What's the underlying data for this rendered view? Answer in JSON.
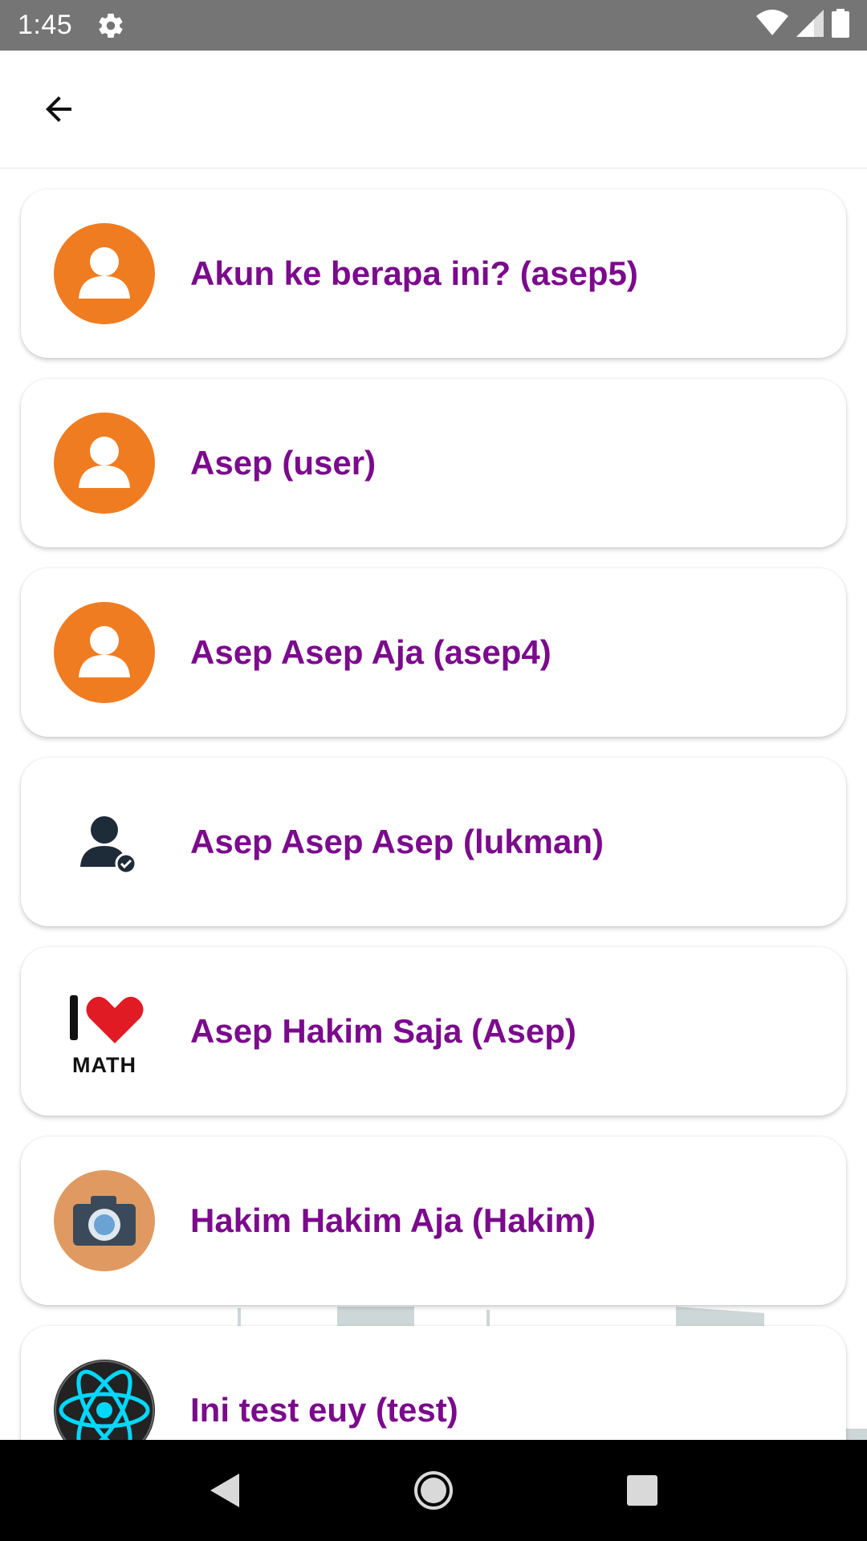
{
  "status_bar": {
    "time": "1:45",
    "icons": [
      "gear-icon",
      "wifi-icon",
      "signal-icon",
      "battery-icon"
    ]
  },
  "app_bar": {
    "back_icon": "arrow-back-icon"
  },
  "accounts": [
    {
      "label": "Akun ke berapa ini? (asep5)",
      "avatar": "default-user-avatar"
    },
    {
      "label": "Asep (user)",
      "avatar": "default-user-avatar"
    },
    {
      "label": "Asep Asep Aja (asep4)",
      "avatar": "default-user-avatar"
    },
    {
      "label": "Asep Asep Asep (lukman)",
      "avatar": "verified-user-avatar"
    },
    {
      "label": "Asep Hakim Saja (Asep)",
      "avatar": "i-love-math-avatar",
      "avatar_text": "MATH"
    },
    {
      "label": "Hakim Hakim Aja (Hakim)",
      "avatar": "camera-avatar"
    },
    {
      "label": "Ini test euy (test)",
      "avatar": "react-logo-avatar"
    }
  ],
  "colors": {
    "status_bar": "#757575",
    "label_text": "#7b0a8c",
    "default_avatar": "#f07c21",
    "camera_avatar_bg": "#e09a61",
    "nav_bar": "#000000"
  },
  "nav_bar": {
    "icons": [
      "back-triangle-icon",
      "home-circle-icon",
      "recents-square-icon"
    ]
  }
}
